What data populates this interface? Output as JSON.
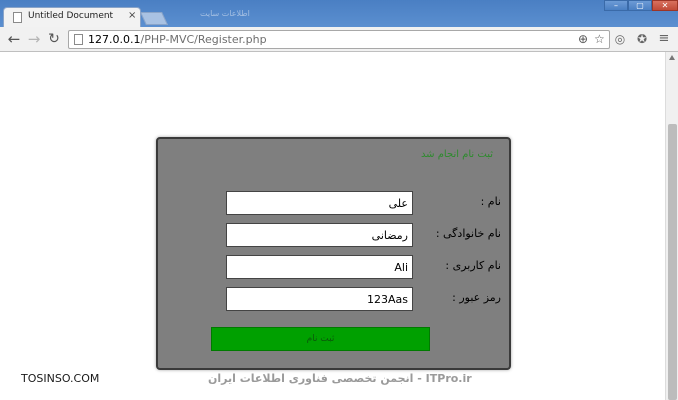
{
  "browser": {
    "tab": {
      "title": "Untitled Document",
      "close_glyph": "×",
      "page_icon": "page-icon"
    },
    "ghost_tab_title": "اطلاعات سایت",
    "window_controls": {
      "minimize": "–",
      "maximize": "▢",
      "close": "✕"
    },
    "nav": {
      "back_glyph": "←",
      "forward_glyph": "→",
      "reload_glyph": "↻"
    },
    "address": {
      "host": "127.0.0.1",
      "path": "/PHP-MVC/Register.php"
    },
    "omnibox_icons": {
      "zoom": "zoom-icon",
      "star": "bookmark-star-icon",
      "zoom_glyph": "⊕",
      "star_glyph": "☆"
    },
    "toolbar_icons": {
      "globe_glyph": "◎",
      "extension_glyph": "✪",
      "menu_glyph": "≡"
    }
  },
  "form": {
    "success_message": "ثبت نام انجام شد",
    "fields": [
      {
        "label": "نام :",
        "value": "علی"
      },
      {
        "label": "نام خانوادگی :",
        "value": "رمضانی"
      },
      {
        "label": "نام کاربری :",
        "value": "Ali"
      },
      {
        "label": "رمز عبور :",
        "value": "123Aas"
      }
    ],
    "submit_label": "ثبت نام"
  },
  "watermark": {
    "left": "TOSINSO.COM",
    "center": "ITPro.ir - انجمن تخصصی فناوری اطلاعات ایران"
  },
  "colors": {
    "panel_bg": "#7f7f7f",
    "submit_bg": "#00a000",
    "success_text": "#2e8b2e",
    "tabstrip_bg": "#4a7fc3"
  }
}
